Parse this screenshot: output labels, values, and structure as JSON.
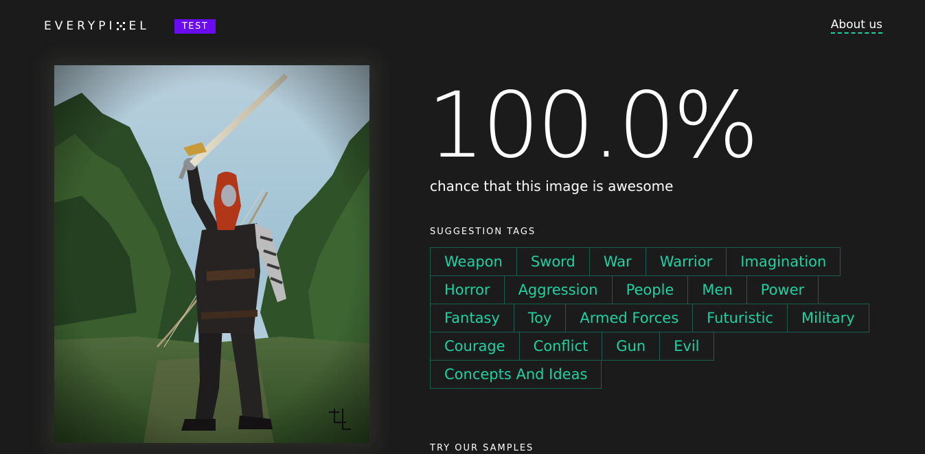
{
  "header": {
    "logo_text_left": "EVERYPI",
    "logo_text_right": "EL",
    "logo_icon": "x-mark-icon",
    "badge_label": "TEST",
    "about_link": "About us"
  },
  "result": {
    "score": "100.0%",
    "subtitle": "chance that this image is awesome"
  },
  "tags_section": {
    "label": "SUGGESTION TAGS",
    "rows": [
      [
        "Weapon",
        "Sword",
        "War",
        "Warrior",
        "Imagination"
      ],
      [
        "Horror",
        "Aggression",
        "People",
        "Men",
        "Power"
      ],
      [
        "Fantasy",
        "Toy",
        "Armed Forces",
        "Futuristic",
        "Military"
      ],
      [
        "Courage",
        "Conflict",
        "Gun",
        "Evil"
      ],
      [
        "Concepts And Ideas"
      ]
    ]
  },
  "samples_section": {
    "label": "TRY OUR SAMPLES"
  },
  "colors": {
    "background": "#1b1b1b",
    "accent": "#1fd1a1",
    "badge": "#6a0cf0",
    "tag_border": "#1a5e52"
  }
}
